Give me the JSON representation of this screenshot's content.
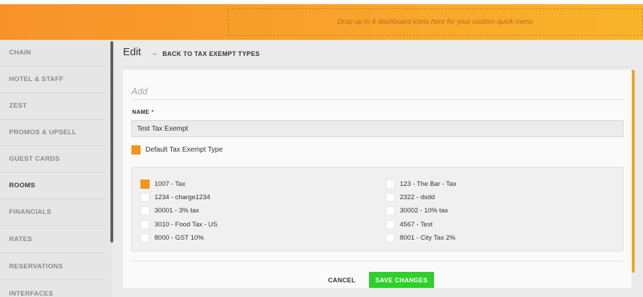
{
  "header": {
    "quick_menu_placeholder": "Drop up to 8 dashboard icons here for your custom quick menu",
    "gradient_colors": [
      "#f7922a",
      "#f9b42a"
    ]
  },
  "sidebar": {
    "items": [
      {
        "label": "CHAIN",
        "active": false
      },
      {
        "label": "HOTEL & STAFF",
        "active": false
      },
      {
        "label": "ZEST",
        "active": false
      },
      {
        "label": "PROMOS & UPSELL",
        "active": false
      },
      {
        "label": "GUEST CARDS",
        "active": false
      },
      {
        "label": "ROOMS",
        "active": true
      },
      {
        "label": "FINANCIALS",
        "active": false
      },
      {
        "label": "RATES",
        "active": false
      },
      {
        "label": "RESERVATIONS",
        "active": false
      },
      {
        "label": "INTERFACES",
        "active": false
      }
    ]
  },
  "page": {
    "title": "Edit",
    "back_link": "BACK TO TAX EXEMPT TYPES",
    "back_icon": "arrow-left-icon"
  },
  "form": {
    "heading": "Add",
    "name_label": "NAME",
    "required_marker": "*",
    "name_value": "Test Tax Exempt",
    "default_label": "Default Tax Exempt Type",
    "default_checked": true
  },
  "exempt_items": [
    {
      "label": "1007 - Tax",
      "checked": true
    },
    {
      "label": "123 - The Bar - Tax",
      "checked": false
    },
    {
      "label": "1234 - charge1234",
      "checked": false
    },
    {
      "label": "2322 - dsdd",
      "checked": false
    },
    {
      "label": "30001 - 3% tax",
      "checked": false
    },
    {
      "label": "30002 - 10% tax",
      "checked": false
    },
    {
      "label": "3010 - Food Tax - US",
      "checked": false
    },
    {
      "label": "4567 - Test",
      "checked": false
    },
    {
      "label": "8000 - GST 10%",
      "checked": false
    },
    {
      "label": "8001 - City Tax 2%",
      "checked": false
    }
  ],
  "actions": {
    "cancel": "CANCEL",
    "save": "SAVE CHANGES",
    "save_color": "#2ed02a",
    "accent_color": "#f7941d"
  }
}
